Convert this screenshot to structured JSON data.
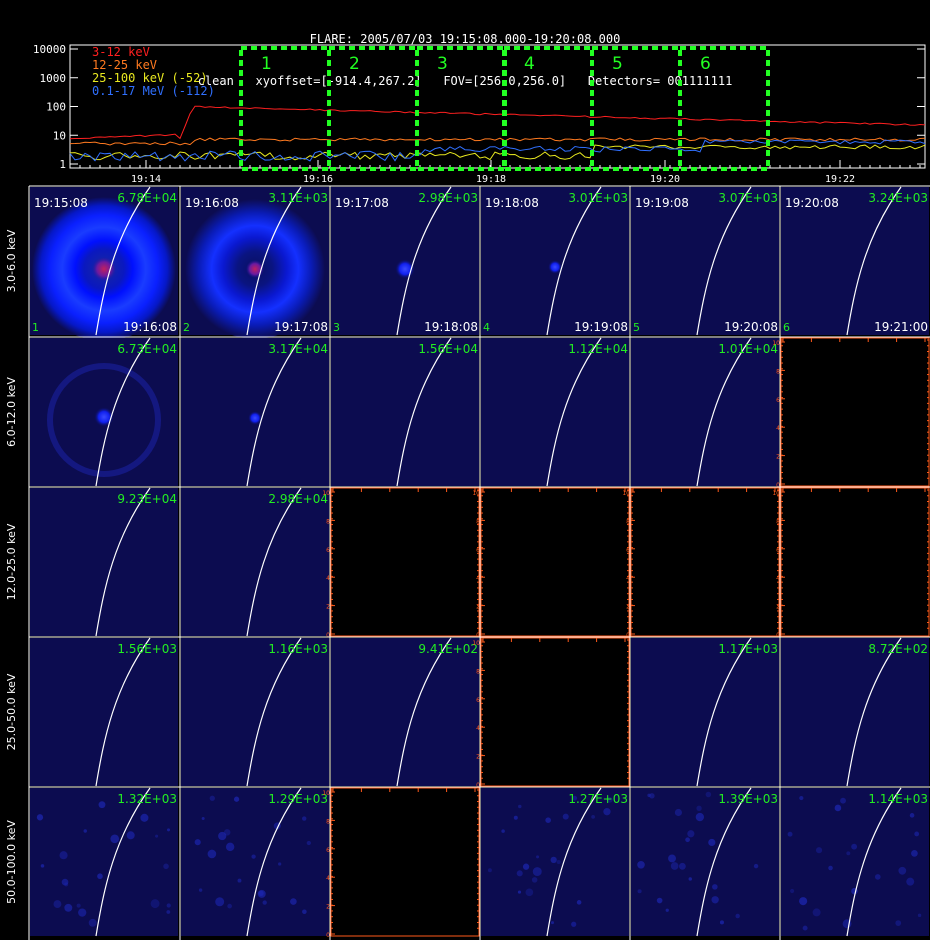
{
  "header": {
    "line1": "FLARE: 2005/07/03 19:15:08.000-19:20:08.000",
    "line2": "clean   xyoffset=[-914.4,267.2]   FOV=[256.0,256.0]   Detectors= 001111111"
  },
  "lightcurve": {
    "legend": [
      {
        "label": "3-12 keV",
        "color": "#ff2020"
      },
      {
        "label": "12-25 keV",
        "color": "#ff7a20"
      },
      {
        "label": "25-100 keV (-52)",
        "color": "#e8e820"
      },
      {
        "label": "0.1-17 MeV (-112)",
        "color": "#3070ff"
      }
    ],
    "y_ticks": [
      "10000",
      "1000",
      "100",
      "10",
      "1"
    ],
    "x_ticks": [
      "19:14",
      "19:16",
      "19:18",
      "19:20",
      "19:22"
    ],
    "intervals": [
      "1",
      "2",
      "3",
      "4",
      "5",
      "6"
    ],
    "interval_color": "#22ff22"
  },
  "rows": [
    {
      "energy": "3.0-6.0 keV",
      "cells": [
        {
          "peak": "6.78E+04",
          "start": "19:15:08",
          "end": "19:16:08",
          "idx": "1",
          "img": "ring"
        },
        {
          "peak": "3.11E+03",
          "start": "19:16:08",
          "end": "19:17:08",
          "idx": "2",
          "img": "ring2"
        },
        {
          "peak": "2.98E+03",
          "start": "19:17:08",
          "end": "19:18:08",
          "idx": "3",
          "img": "spot"
        },
        {
          "peak": "3.01E+03",
          "start": "19:18:08",
          "end": "19:19:08",
          "idx": "4",
          "img": "spot_small"
        },
        {
          "peak": "3.07E+03",
          "start": "19:19:08",
          "end": "19:20:08",
          "idx": "5",
          "img": "plain"
        },
        {
          "peak": "3.24E+03",
          "start": "19:20:08",
          "end": "19:21:00",
          "idx": "6",
          "img": "plain"
        }
      ]
    },
    {
      "energy": "6.0-12.0 keV",
      "cells": [
        {
          "peak": "6.73E+04",
          "img": "faint_ring"
        },
        {
          "peak": "3.17E+04",
          "img": "spot_small"
        },
        {
          "peak": "1.56E+04",
          "img": "plain"
        },
        {
          "peak": "1.12E+04",
          "img": "plain"
        },
        {
          "peak": "1.01E+04",
          "img": "plain"
        },
        {
          "img": "empty"
        }
      ]
    },
    {
      "energy": "12.0-25.0 keV",
      "cells": [
        {
          "peak": "9.23E+04",
          "img": "plain"
        },
        {
          "peak": "2.98E+04",
          "img": "plain"
        },
        {
          "img": "empty"
        },
        {
          "img": "empty"
        },
        {
          "img": "empty"
        },
        {
          "img": "empty"
        }
      ]
    },
    {
      "energy": "25.0-50.0 keV",
      "cells": [
        {
          "peak": "1.56E+03",
          "img": "plain"
        },
        {
          "peak": "1.16E+03",
          "img": "plain"
        },
        {
          "peak": "9.41E+02",
          "img": "plain"
        },
        {
          "img": "empty"
        },
        {
          "peak": "1.17E+03",
          "img": "plain"
        },
        {
          "peak": "8.72E+02",
          "img": "plain"
        }
      ]
    },
    {
      "energy": "50.0-100.0 keV",
      "cells": [
        {
          "peak": "1.32E+03",
          "img": "noise"
        },
        {
          "peak": "1.29E+03",
          "img": "noise"
        },
        {
          "img": "empty"
        },
        {
          "peak": "1.27E+03",
          "img": "noise"
        },
        {
          "peak": "1.39E+03",
          "img": "noise"
        },
        {
          "peak": "1.14E+03",
          "img": "noise"
        }
      ]
    }
  ],
  "empty_axis_ticks": [
    "0",
    "2",
    "4",
    "6",
    "8",
    "10"
  ],
  "colors": {
    "peak": "#22ee22",
    "axis": "#ff5a1a",
    "panel": "#0c0c50",
    "limb": "#ffffff"
  }
}
